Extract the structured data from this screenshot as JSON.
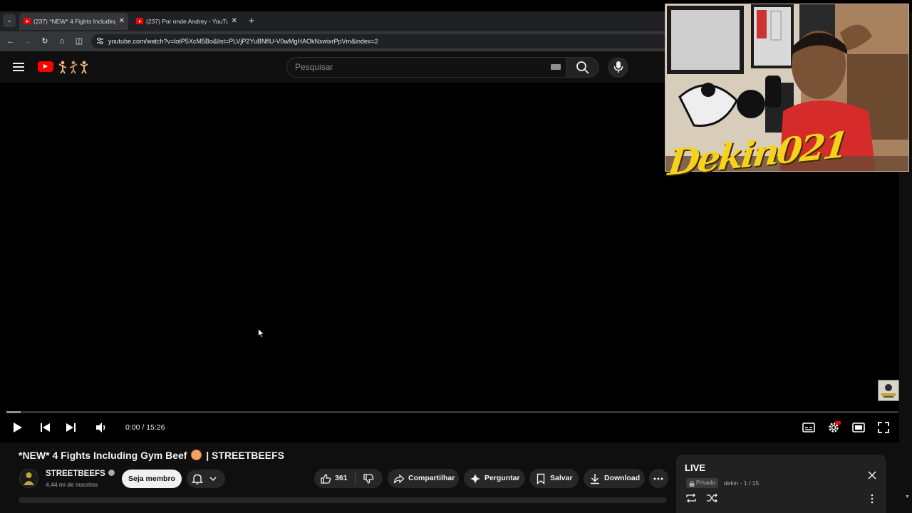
{
  "browser": {
    "tabs": [
      {
        "label": "(237) *NEW* 4 Fights Including",
        "active": true
      },
      {
        "label": "(237) Por onde Andrey - YouTu",
        "active": false
      }
    ],
    "url": "youtube.com/watch?v=lotP5XcM5Bo&list=PLVjP2YuBNflU-V0wMgHAOkNxwixrPpVm&index=2"
  },
  "header": {
    "search_placeholder": "Pesquisar"
  },
  "overlay": {
    "streamer_name": "Dekin021"
  },
  "player": {
    "time": "0:00 / 15:26",
    "progress": 0.0
  },
  "video": {
    "title": "*NEW* 4 Fights Including Gym Beef",
    "title_suffix": "| STREETBEEFS",
    "channel": "STREETBEEFS",
    "subscribers": "4,44 mi de inscritos",
    "join_label": "Seja membro",
    "likes": "361",
    "share_label": "Compartilhar",
    "ask_label": "Perguntar",
    "save_label": "Salvar",
    "download_label": "Download"
  },
  "playlist": {
    "title": "LIVE",
    "privacy": "Privado",
    "meta": "dekin - 1 / 15"
  },
  "colors": {
    "brand_red": "#ff0000",
    "background": "#0f0f0f",
    "streamer_yellow": "#f7d21a"
  }
}
